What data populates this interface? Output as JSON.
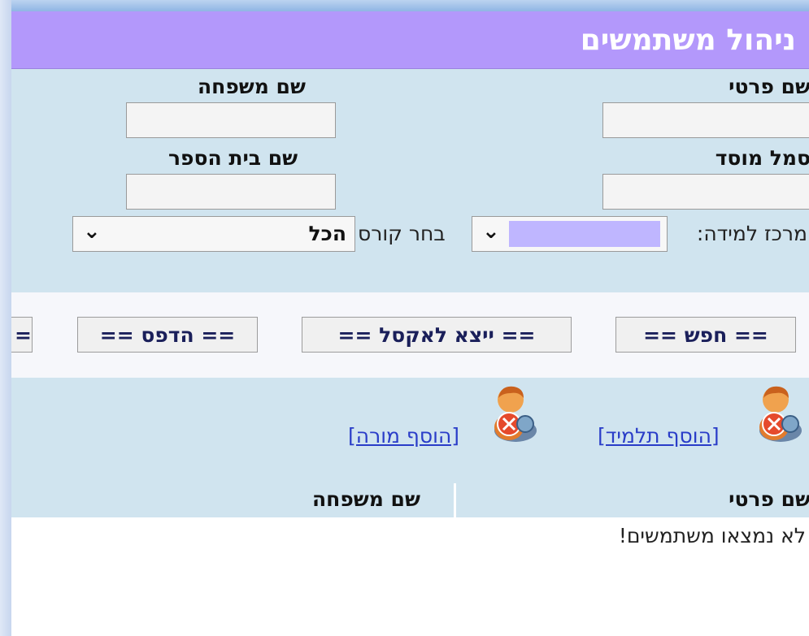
{
  "header": {
    "title": "ניהול משתמשים"
  },
  "filters": {
    "first_name_label": "שם פרטי",
    "last_name_label": "שם משפחה",
    "institution_code_label": "סמל מוסד",
    "school_name_label": "שם בית הספר",
    "learning_center_label": "מרכז למידה:",
    "choose_course_label": "בחר קורס",
    "course_select_value": "הכל",
    "first_name_value": "",
    "last_name_value": "",
    "institution_code_value": "",
    "school_name_value": ""
  },
  "buttons": {
    "search": "==  חפש  ==",
    "export_excel": "==  ייצא לאקסל  ==",
    "print": "== הדפס ==",
    "partial": "="
  },
  "links": {
    "add_student": "[הוסף תלמיד]",
    "add_teacher": "[הוסף מורה]"
  },
  "table": {
    "columns": [
      "שם פרטי",
      "שם משפחה"
    ],
    "empty_message": "לא נמצאו משתמשים!"
  },
  "colors": {
    "header_bg": "#b398fb",
    "panel_bg": "#d0e4ef",
    "link": "#2a3dc8"
  },
  "icons": {
    "add_student_icon": "user-add-icon",
    "add_teacher_icon": "user-add-icon"
  }
}
